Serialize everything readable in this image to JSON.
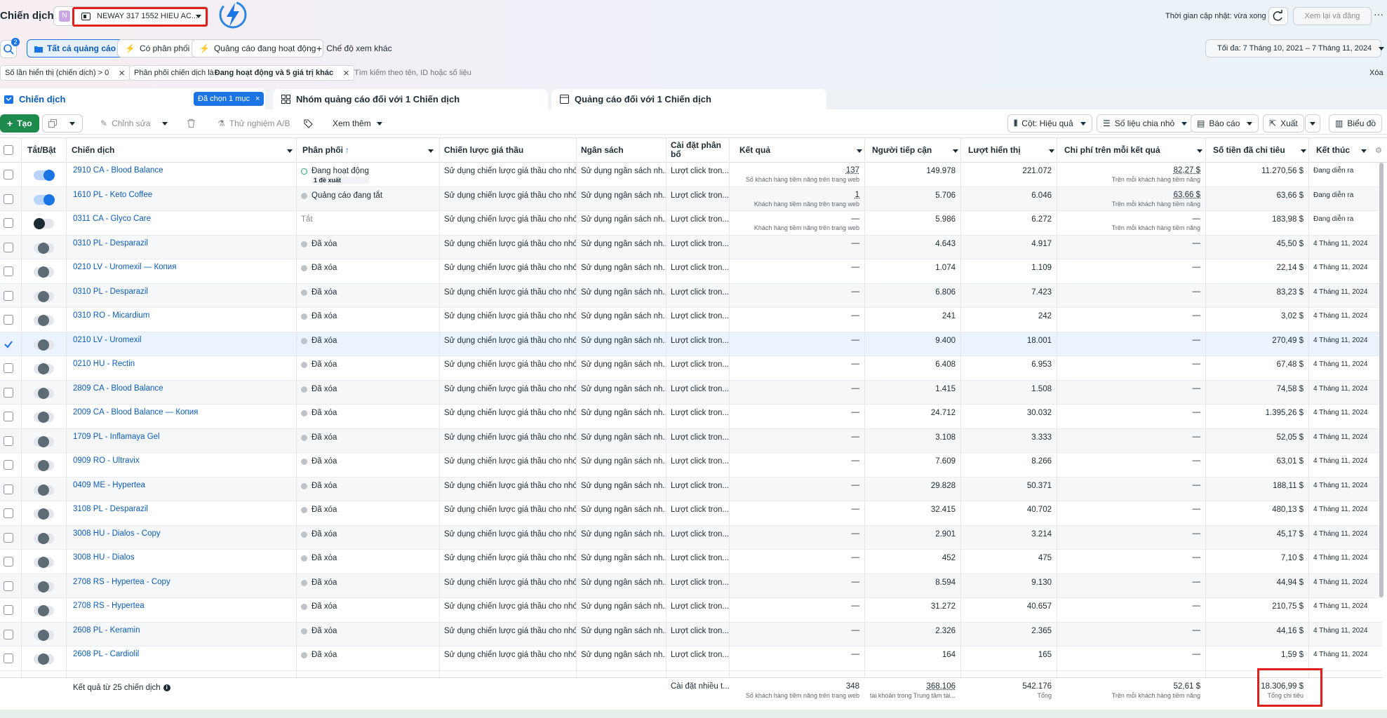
{
  "header": {
    "title": "Chiến dịch",
    "account_initial": "N",
    "account_name": "NEWAY 317 1552 HIEU AC...",
    "update_status": "Thời gian cập nhật: vừa xong",
    "review_publish": "Xem lại và đăng",
    "search_badge": "2"
  },
  "filters": {
    "all_ads": "Tất cả quảng cáo",
    "has_delivery": "Có phân phối",
    "active_ads": "Quảng cáo đang hoạt động",
    "other_view": "Chế độ xem khác",
    "date_range": "Tối đa: 7 Tháng 10, 2021 – 7 Tháng 11, 2024"
  },
  "chips": {
    "chip1": "Số lần hiển thị (chiến dịch) > 0",
    "chip2_prefix": "Phân phối chiến dịch là ",
    "chip2_bold": "Đang hoạt động và 5 giá trị khác",
    "search_placeholder": "Tìm kiếm theo tên, ID hoặc số liệu",
    "clear": "Xóa"
  },
  "tabs": {
    "campaigns": "Chiến dịch",
    "selected": "Đã chọn 1 mục",
    "adsets": "Nhóm quảng cáo đối với 1 Chiến dịch",
    "ads": "Quảng cáo đối với 1 Chiến dịch"
  },
  "toolbar": {
    "create": "Tạo",
    "edit": "Chỉnh sửa",
    "ab_test": "Thử nghiệm A/B",
    "more": "Xem thêm",
    "columns": "Cột: Hiệu quả",
    "breakdown": "Số liệu chia nhỏ",
    "reports": "Báo cáo",
    "export": "Xuất",
    "charts": "Biểu đồ"
  },
  "columns": {
    "toggle": "Tắt/Bật",
    "campaign": "Chiến dịch",
    "delivery": "Phân phối",
    "strategy": "Chiến lược giá thầu",
    "budget": "Ngân sách",
    "setting1": "Cài đặt phân",
    "setting2": "bổ",
    "results": "Kết quả",
    "reach": "Người tiếp cận",
    "impressions": "Lượt hiển thị",
    "cpr": "Chi phí trên mỗi kết quả",
    "spent": "Số tiền đã chi tiêu",
    "end": "Kết thúc"
  },
  "rows": [
    {
      "name": "2910 CA - Blood Balance",
      "status": "Đang hoạt động",
      "rec": "1 đề xuất",
      "dot": "ring",
      "toggle": "on",
      "strategy": "Sử dụng chiến lược giá thầu cho nhó...",
      "budget": "Sử dụng ngân sách nh...",
      "setting": "Lượt click tron...",
      "result": "137",
      "result_sub": "Số khách hàng tiềm năng trên trang web",
      "reach": "149.978",
      "impr": "221.072",
      "cpr": "82,27 $",
      "cpr_sub": "Trên mỗi khách hàng tiềm năng",
      "spent": "11.270,56 $",
      "end": "Đang diễn ra"
    },
    {
      "name": "1610 PL - Keto Coffee",
      "status": "Quảng cáo đang tắt",
      "rec": "",
      "dot": "grey",
      "toggle": "on",
      "strategy": "Sử dụng chiến lược giá thầu cho nhó...",
      "budget": "Sử dụng ngân sách nh...",
      "setting": "Lượt click tron...",
      "result": "1",
      "result_sub": "Khách hàng tiềm năng trên trang web",
      "reach": "5.706",
      "impr": "6.046",
      "cpr": "63,66 $",
      "cpr_sub": "Trên mỗi khách hàng tiềm năng",
      "spent": "63,66 $",
      "end": "Đang diễn ra"
    },
    {
      "name": "0311 CA - Glyco Care",
      "status": "Tắt",
      "rec": "",
      "dot": "none",
      "toggle": "offk",
      "strategy": "Sử dụng chiến lược giá thầu cho nhó...",
      "budget": "Sử dụng ngân sách nh...",
      "setting": "Lượt click tron...",
      "result": "—",
      "result_sub": "Khách hàng tiềm năng trên trang web",
      "reach": "5.986",
      "impr": "6.272",
      "cpr": "—",
      "cpr_sub": "Trên mỗi khách hàng tiềm năng",
      "spent": "183,98 $",
      "end": "Đang diễn ra"
    },
    {
      "name": "0310 PL - Desparazil",
      "status": "Đã xóa",
      "dot": "grey",
      "toggle": "off",
      "strategy": "Sử dụng chiến lược giá thầu cho nhó...",
      "budget": "Sử dụng ngân sách nh...",
      "setting": "Lượt click tron...",
      "result": "—",
      "result_sub": "",
      "reach": "4.643",
      "impr": "4.917",
      "cpr": "—",
      "cpr_sub": "",
      "spent": "45,50 $",
      "end": "4 Tháng 11, 2024"
    },
    {
      "name": "0210 LV - Uromexil — Копия",
      "status": "Đã xóa",
      "dot": "grey",
      "toggle": "off",
      "strategy": "Sử dụng chiến lược giá thầu cho nhó...",
      "budget": "Sử dụng ngân sách nh...",
      "setting": "Lượt click tron...",
      "result": "—",
      "result_sub": "",
      "reach": "1.074",
      "impr": "1.109",
      "cpr": "—",
      "cpr_sub": "",
      "spent": "22,14 $",
      "end": "4 Tháng 11, 2024"
    },
    {
      "name": "0310 PL - Desparazil",
      "status": "Đã xóa",
      "dot": "grey",
      "toggle": "off",
      "strategy": "Sử dụng chiến lược giá thầu cho nhó...",
      "budget": "Sử dụng ngân sách nh...",
      "setting": "Lượt click tron...",
      "result": "—",
      "result_sub": "",
      "reach": "6.806",
      "impr": "7.423",
      "cpr": "—",
      "cpr_sub": "",
      "spent": "83,23 $",
      "end": "4 Tháng 11, 2024"
    },
    {
      "name": "0310 RO - Micardium",
      "status": "Đã xóa",
      "dot": "grey",
      "toggle": "off",
      "strategy": "Sử dụng chiến lược giá thầu cho nhó...",
      "budget": "Sử dụng ngân sách nh...",
      "setting": "Lượt click tron...",
      "result": "—",
      "result_sub": "",
      "reach": "241",
      "impr": "242",
      "cpr": "—",
      "cpr_sub": "",
      "spent": "3,02 $",
      "end": "4 Tháng 11, 2024"
    },
    {
      "name": "0210 LV - Uromexil",
      "status": "Đã xóa",
      "dot": "grey",
      "toggle": "off",
      "checked": true,
      "strategy": "Sử dụng chiến lược giá thầu cho nhó...",
      "budget": "Sử dụng ngân sách nh...",
      "setting": "Lượt click tron...",
      "result": "—",
      "result_sub": "",
      "reach": "9.400",
      "impr": "18.001",
      "cpr": "—",
      "cpr_sub": "",
      "spent": "270,49 $",
      "end": "4 Tháng 11, 2024"
    },
    {
      "name": "0210 HU - Rectin",
      "status": "Đã xóa",
      "dot": "grey",
      "toggle": "off",
      "strategy": "Sử dụng chiến lược giá thầu cho nhó...",
      "budget": "Sử dụng ngân sách nh...",
      "setting": "Lượt click tron...",
      "result": "—",
      "result_sub": "",
      "reach": "6.408",
      "impr": "6.953",
      "cpr": "—",
      "cpr_sub": "",
      "spent": "67,48 $",
      "end": "4 Tháng 11, 2024"
    },
    {
      "name": "2809 CA - Blood Balance",
      "status": "Đã xóa",
      "dot": "grey",
      "toggle": "off",
      "strategy": "Sử dụng chiến lược giá thầu cho nhó...",
      "budget": "Sử dụng ngân sách nh...",
      "setting": "Lượt click tron...",
      "result": "—",
      "result_sub": "",
      "reach": "1.415",
      "impr": "1.508",
      "cpr": "—",
      "cpr_sub": "",
      "spent": "74,58 $",
      "end": "4 Tháng 11, 2024"
    },
    {
      "name": "2009 CA - Blood Balance — Копия",
      "status": "Đã xóa",
      "dot": "grey",
      "toggle": "off",
      "strategy": "Sử dụng chiến lược giá thầu cho nhó...",
      "budget": "Sử dụng ngân sách nh...",
      "setting": "Lượt click tron...",
      "result": "—",
      "result_sub": "",
      "reach": "24.712",
      "impr": "30.032",
      "cpr": "—",
      "cpr_sub": "",
      "spent": "1.395,26 $",
      "end": "4 Tháng 11, 2024"
    },
    {
      "name": "1709 PL - Inflamaya Gel",
      "status": "Đã xóa",
      "dot": "grey",
      "toggle": "off",
      "strategy": "Sử dụng chiến lược giá thầu cho nhó...",
      "budget": "Sử dụng ngân sách nh...",
      "setting": "Lượt click tron...",
      "result": "—",
      "result_sub": "",
      "reach": "3.108",
      "impr": "3.333",
      "cpr": "—",
      "cpr_sub": "",
      "spent": "52,05 $",
      "end": "4 Tháng 11, 2024"
    },
    {
      "name": "0909 RO - Ultravix",
      "status": "Đã xóa",
      "dot": "grey",
      "toggle": "off",
      "strategy": "Sử dụng chiến lược giá thầu cho nhó...",
      "budget": "Sử dụng ngân sách nh...",
      "setting": "Lượt click tron...",
      "result": "—",
      "result_sub": "",
      "reach": "7.609",
      "impr": "8.266",
      "cpr": "—",
      "cpr_sub": "",
      "spent": "63,01 $",
      "end": "4 Tháng 11, 2024"
    },
    {
      "name": "0409 ME - Hypertea",
      "status": "Đã xóa",
      "dot": "grey",
      "toggle": "off",
      "strategy": "Sử dụng chiến lược giá thầu cho nhó...",
      "budget": "Sử dụng ngân sách nh...",
      "setting": "Lượt click tron...",
      "result": "—",
      "result_sub": "",
      "reach": "29.828",
      "impr": "50.371",
      "cpr": "—",
      "cpr_sub": "",
      "spent": "188,11 $",
      "end": "4 Tháng 11, 2024"
    },
    {
      "name": "3108 PL - Desparazil",
      "status": "Đã xóa",
      "dot": "grey",
      "toggle": "off",
      "strategy": "Sử dụng chiến lược giá thầu cho nhó...",
      "budget": "Sử dụng ngân sách nh...",
      "setting": "Lượt click tron...",
      "result": "—",
      "result_sub": "",
      "reach": "32.415",
      "impr": "40.702",
      "cpr": "—",
      "cpr_sub": "",
      "spent": "480,13 $",
      "end": "4 Tháng 11, 2024"
    },
    {
      "name": "3008 HU - Dialos - Copy",
      "status": "Đã xóa",
      "dot": "grey",
      "toggle": "off",
      "strategy": "Sử dụng chiến lược giá thầu cho nhó...",
      "budget": "Sử dụng ngân sách nh...",
      "setting": "Lượt click tron...",
      "result": "—",
      "result_sub": "",
      "reach": "2.901",
      "impr": "3.214",
      "cpr": "—",
      "cpr_sub": "",
      "spent": "45,17 $",
      "end": "4 Tháng 11, 2024"
    },
    {
      "name": "3008 HU - Dialos",
      "status": "Đã xóa",
      "dot": "grey",
      "toggle": "off",
      "strategy": "Sử dụng chiến lược giá thầu cho nhó...",
      "budget": "Sử dụng ngân sách nh...",
      "setting": "Lượt click tron...",
      "result": "—",
      "result_sub": "",
      "reach": "452",
      "impr": "475",
      "cpr": "—",
      "cpr_sub": "",
      "spent": "7,10 $",
      "end": "4 Tháng 11, 2024"
    },
    {
      "name": "2708 RS - Hypertea - Copy",
      "status": "Đã xóa",
      "dot": "grey",
      "toggle": "off",
      "strategy": "Sử dụng chiến lược giá thầu cho nhó...",
      "budget": "Sử dụng ngân sách nh...",
      "setting": "Lượt click tron...",
      "result": "—",
      "result_sub": "",
      "reach": "8.594",
      "impr": "9.130",
      "cpr": "—",
      "cpr_sub": "",
      "spent": "44,94 $",
      "end": "4 Tháng 11, 2024"
    },
    {
      "name": "2708 RS - Hypertea",
      "status": "Đã xóa",
      "dot": "grey",
      "toggle": "off",
      "strategy": "Sử dụng chiến lược giá thầu cho nhó...",
      "budget": "Sử dụng ngân sách nh...",
      "setting": "Lượt click tron...",
      "result": "—",
      "result_sub": "",
      "reach": "31.272",
      "impr": "40.657",
      "cpr": "—",
      "cpr_sub": "",
      "spent": "210,75 $",
      "end": "4 Tháng 11, 2024"
    },
    {
      "name": "2608 PL - Keramin",
      "status": "Đã xóa",
      "dot": "grey",
      "toggle": "off",
      "strategy": "Sử dụng chiến lược giá thầu cho nhó...",
      "budget": "Sử dụng ngân sách nh...",
      "setting": "Lượt click tron...",
      "result": "—",
      "result_sub": "",
      "reach": "2.326",
      "impr": "2.365",
      "cpr": "—",
      "cpr_sub": "",
      "spent": "44,16 $",
      "end": "4 Tháng 11, 2024"
    },
    {
      "name": "2608 PL - Cardiolil",
      "status": "Đã xóa",
      "dot": "grey",
      "toggle": "off",
      "strategy": "Sử dụng chiến lược giá thầu cho nhó...",
      "budget": "Sử dụng ngân sách nh...",
      "setting": "Lượt click tron...",
      "result": "—",
      "result_sub": "",
      "reach": "164",
      "impr": "165",
      "cpr": "—",
      "cpr_sub": "",
      "spent": "1,59 $",
      "end": "4 Tháng 11, 2024"
    }
  ],
  "footer": {
    "summary": "Kết quả từ 25 chiến dịch",
    "setting": "Cài đặt nhiều t...",
    "results": "348",
    "results_sub": "Số khách hàng tiềm năng trên trang web",
    "reach": "368.106",
    "reach_sub": "tài khoản trong Trung tâm tài...",
    "impr": "542.176",
    "impr_sub": "Tổng",
    "cpr": "52,61 $",
    "cpr_sub": "Trên mỗi khách hàng tiềm năng",
    "spent": "18.306,99 $",
    "spent_sub": "Tổng chi tiêu"
  },
  "colors": {
    "accent": "#1b74e4",
    "link": "#0b5cb8",
    "create": "#1e8a4c",
    "highlight": "#e0201c"
  }
}
